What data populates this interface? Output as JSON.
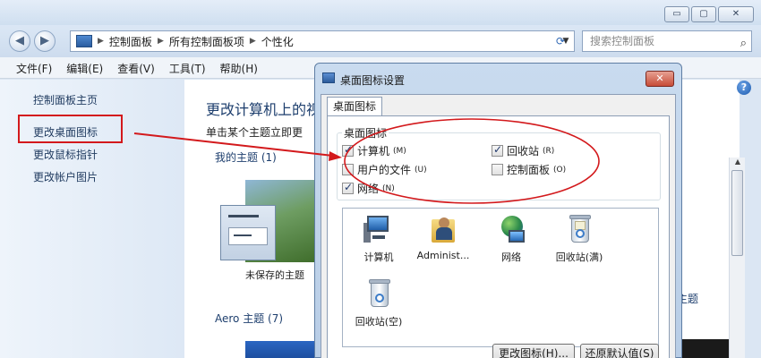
{
  "window": {
    "controls": {
      "minimize": "▭",
      "maximize": "▢",
      "close": "✕"
    }
  },
  "addressbar": {
    "back": "◀",
    "forward": "▶",
    "crumbs": [
      "控制面板",
      "所有控制面板项",
      "个性化"
    ],
    "search_placeholder": "搜索控制面板"
  },
  "menubar": {
    "items": [
      "文件(F)",
      "编辑(E)",
      "查看(V)",
      "工具(T)",
      "帮助(H)"
    ]
  },
  "leftpane": {
    "links": [
      "控制面板主页",
      "更改桌面图标",
      "更改鼠标指针",
      "更改帐户图片"
    ]
  },
  "content": {
    "heading": "更改计算机上的视",
    "subtitle": "单击某个主题立即更",
    "my_themes": "我的主题 (1)",
    "unsaved_theme": "未保存的主题",
    "aero_themes": "Aero 主题 (7)",
    "more_themes": "多主题"
  },
  "dialog": {
    "title": "桌面图标设置",
    "tab": "桌面图标",
    "group_label": "桌面图标",
    "checkboxes": [
      {
        "label": "计算机",
        "accel": "(M)",
        "checked": true
      },
      {
        "label": "回收站",
        "accel": "(R)",
        "checked": true
      },
      {
        "label": "用户的文件",
        "accel": "(U)",
        "checked": false
      },
      {
        "label": "控制面板",
        "accel": "(O)",
        "checked": false
      },
      {
        "label": "网络",
        "accel": "(N)",
        "checked": true
      }
    ],
    "icons": [
      {
        "label": "计算机",
        "icon": "computer-icon"
      },
      {
        "label": "Administ...",
        "icon": "user-folder-icon"
      },
      {
        "label": "网络",
        "icon": "network-icon"
      },
      {
        "label": "回收站(满)",
        "icon": "recycle-bin-full-icon"
      },
      {
        "label": "回收站(空)",
        "icon": "recycle-bin-empty-icon"
      }
    ],
    "buttons": {
      "change_icon": "更改图标(H)...",
      "restore_default": "还原默认值(S)"
    }
  },
  "colors": {
    "annotation_red": "#d3191c",
    "link_blue": "#1f3a5f",
    "heading_blue": "#1e3f6e"
  }
}
